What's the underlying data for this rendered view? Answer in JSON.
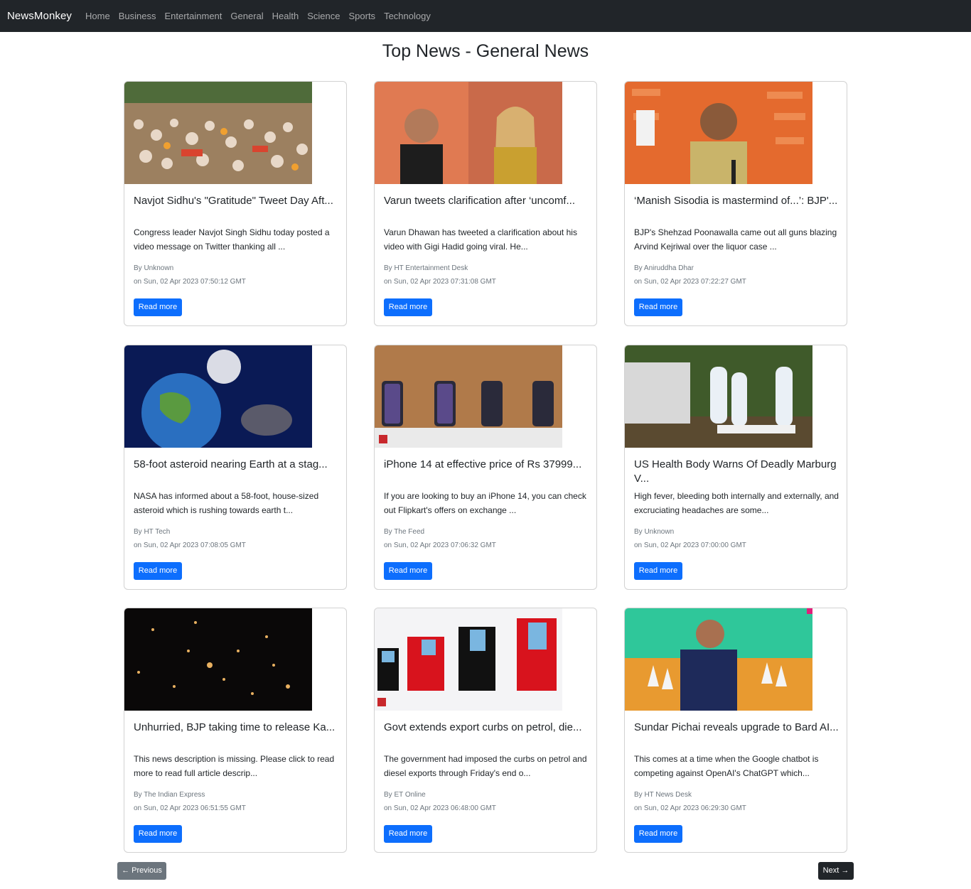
{
  "navbar": {
    "brand": "NewsMonkey",
    "links": [
      "Home",
      "Business",
      "Entertainment",
      "General",
      "Health",
      "Science",
      "Sports",
      "Technology"
    ]
  },
  "page": {
    "title": "Top News - General News"
  },
  "articles": [
    {
      "title": "Navjot Sidhu's \"Gratitude\" Tweet Day Aft...",
      "description": "Congress leader Navjot Singh Sidhu today posted a video message on Twitter thanking all ...",
      "author": "By Unknown",
      "date": "on Sun, 02 Apr 2023 07:50:12 GMT",
      "button": "Read more",
      "image": "crowd-photo"
    },
    {
      "title": "Varun tweets clarification after ‘uncomf...",
      "description": "Varun Dhawan has tweeted a clarification about his video with Gigi Hadid going viral. He...",
      "author": "By HT Entertainment Desk",
      "date": "on Sun, 02 Apr 2023 07:31:08 GMT",
      "button": "Read more",
      "image": "celebrities-photo"
    },
    {
      "title": "‘Manish Sisodia is mastermind of...’: BJP'...",
      "description": "BJP's Shehzad Poonawalla came out all guns blazing Arvind Kejriwal over the liquor case ...",
      "author": "By Aniruddha Dhar",
      "date": "on Sun, 02 Apr 2023 07:22:27 GMT",
      "button": "Read more",
      "image": "press-conference-photo"
    },
    {
      "title": "58-foot asteroid nearing Earth at a stag...",
      "description": "NASA has informed about a 58-foot, house-sized asteroid which is rushing towards earth t...",
      "author": "By HT Tech",
      "date": "on Sun, 02 Apr 2023 07:08:05 GMT",
      "button": "Read more",
      "image": "asteroid-photo"
    },
    {
      "title": "iPhone 14 at effective price of Rs 37999...",
      "description": "If you are looking to buy an iPhone 14, you can check out Flipkart's offers on exchange ...",
      "author": "By The Feed",
      "date": "on Sun, 02 Apr 2023 07:06:32 GMT",
      "button": "Read more",
      "image": "iphones-photo"
    },
    {
      "title": "US Health Body Warns Of Deadly Marburg V...",
      "description": "High fever, bleeding both internally and externally, and excruciating headaches are some...",
      "author": "By Unknown",
      "date": "on Sun, 02 Apr 2023 07:00:00 GMT",
      "button": "Read more",
      "image": "health-workers-photo"
    },
    {
      "title": "Unhurried, BJP taking time to release Ka...",
      "description": "This news description is missing. Please click to read more to read full article descrip...",
      "author": "By The Indian Express",
      "date": "on Sun, 02 Apr 2023 06:51:55 GMT",
      "button": "Read more",
      "image": "galaxies-photo"
    },
    {
      "title": "Govt extends export curbs on petrol, die...",
      "description": "The government had imposed the curbs on petrol and diesel exports through Friday's end o...",
      "author": "By ET Online",
      "date": "on Sun, 02 Apr 2023 06:48:00 GMT",
      "button": "Read more",
      "image": "fuel-pumps-illustration"
    },
    {
      "title": "Sundar Pichai reveals upgrade to Bard AI...",
      "description": "This comes at a time when the Google chatbot is competing against OpenAI's ChatGPT which...",
      "author": "By HT News Desk",
      "date": "on Sun, 02 Apr 2023 06:29:30 GMT",
      "button": "Read more",
      "image": "speaker-photo"
    }
  ],
  "pagination": {
    "previous": "← Previous",
    "next": "Next →"
  }
}
